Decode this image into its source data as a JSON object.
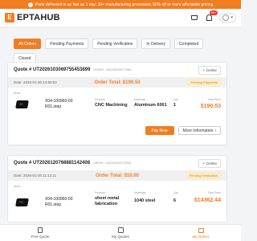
{
  "banner": {
    "text": "Parts delivered in as fast as 1 day; 30+ manufacturing processes; 50% off or more affordable pricing"
  },
  "header": {
    "logo": "EPTAHUB",
    "notif_count": "99+"
  },
  "tabs": [
    {
      "label": "All Orders",
      "active": true
    },
    {
      "label": "Pending Payments",
      "active": false
    },
    {
      "label": "Pending Verification",
      "active": false
    },
    {
      "label": "In Delivery",
      "active": false
    },
    {
      "label": "Completed",
      "active": false
    },
    {
      "label": "Closed",
      "active": false
    }
  ],
  "quotes": [
    {
      "quote_id": "Quote # UT2026103069755453899",
      "order_label": "ORDER › 2602260334770349",
      "delete_label": "Delete",
      "date": "Date: 2026-01-30 14:50:52",
      "order_total": "Order Total: $190.53",
      "status": "Pending Payments",
      "items_label": "Items",
      "file_name": "X04-100960-00 R01.step",
      "process_label": "Process:",
      "process_value": "CNC Machining",
      "materials_label": "Materials:",
      "materials_value": "Aluminum 6061",
      "qty_label": "Qty:",
      "qty_value": "1",
      "total_price_label": "Total Price",
      "total_price_value": "$190.53",
      "pay_label": "Pay Now",
      "more_label": "More Information"
    },
    {
      "quote_id": "Quote # UT2026120768881142408",
      "order_label": "ORDER › 2601200315770348",
      "delete_label": "Delete",
      "date": "Date: 2026-01-20 11:13:11",
      "order_total": "Order Total: $10.00",
      "status": "Pending Verification",
      "items_label": "Items",
      "file_name": "X04-100960-00 R01.step",
      "process_label": "Process:",
      "process_value": "sheet metal fabrication",
      "materials_label": "Materials:",
      "materials_value": "1040 steel",
      "qty_label": "Qty:",
      "qty_value": "6",
      "total_price_label": "Total Price",
      "total_price_value": "$14362.44"
    }
  ],
  "bottom_nav": [
    {
      "label": "Free Quote",
      "icon": "document-icon",
      "active": false
    },
    {
      "label": "My Quotes",
      "icon": "grid-icon",
      "active": false
    },
    {
      "label": "My Orders",
      "icon": "bag-icon",
      "active": true
    }
  ],
  "colors": {
    "accent": "#f07d22",
    "status_bg": "#fcebc9",
    "status_text": "#e08a00"
  }
}
